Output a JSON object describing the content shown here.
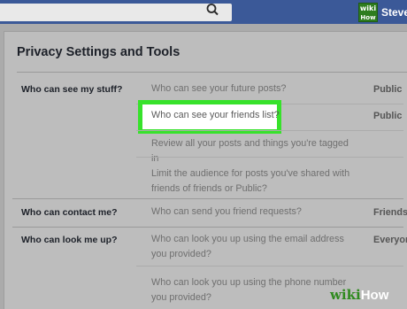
{
  "header": {
    "search_value": "",
    "profile_name": "Steve",
    "wiki_badge_top": "wiki",
    "wiki_badge_bottom": "How"
  },
  "panel": {
    "title": "Privacy Settings and Tools"
  },
  "sections": [
    {
      "label": "Who can see my stuff?",
      "rows": [
        {
          "question": "Who can see your future posts?",
          "value": "Public"
        },
        {
          "question": "Who can see your friends list?",
          "value": "Public",
          "highlighted": true
        },
        {
          "question": "Review all your posts and things you're tagged in",
          "value": ""
        },
        {
          "question": "Limit the audience for posts you've shared with friends of friends or Public?",
          "value": ""
        }
      ]
    },
    {
      "label": "Who can contact me?",
      "rows": [
        {
          "question": "Who can send you friend requests?",
          "value": "Friends"
        }
      ]
    },
    {
      "label": "Who can look me up?",
      "rows": [
        {
          "question": "Who can look you up using the email address you provided?",
          "value": "Everyone"
        },
        {
          "question": "Who can look you up using the phone number you provided?",
          "value": ""
        }
      ]
    }
  ],
  "watermark": {
    "part1": "wiki",
    "part2": "How"
  },
  "colors": {
    "topbar": "#3b5998",
    "highlight_border": "#37e22b",
    "wiki_green": "#2f8a1e"
  }
}
